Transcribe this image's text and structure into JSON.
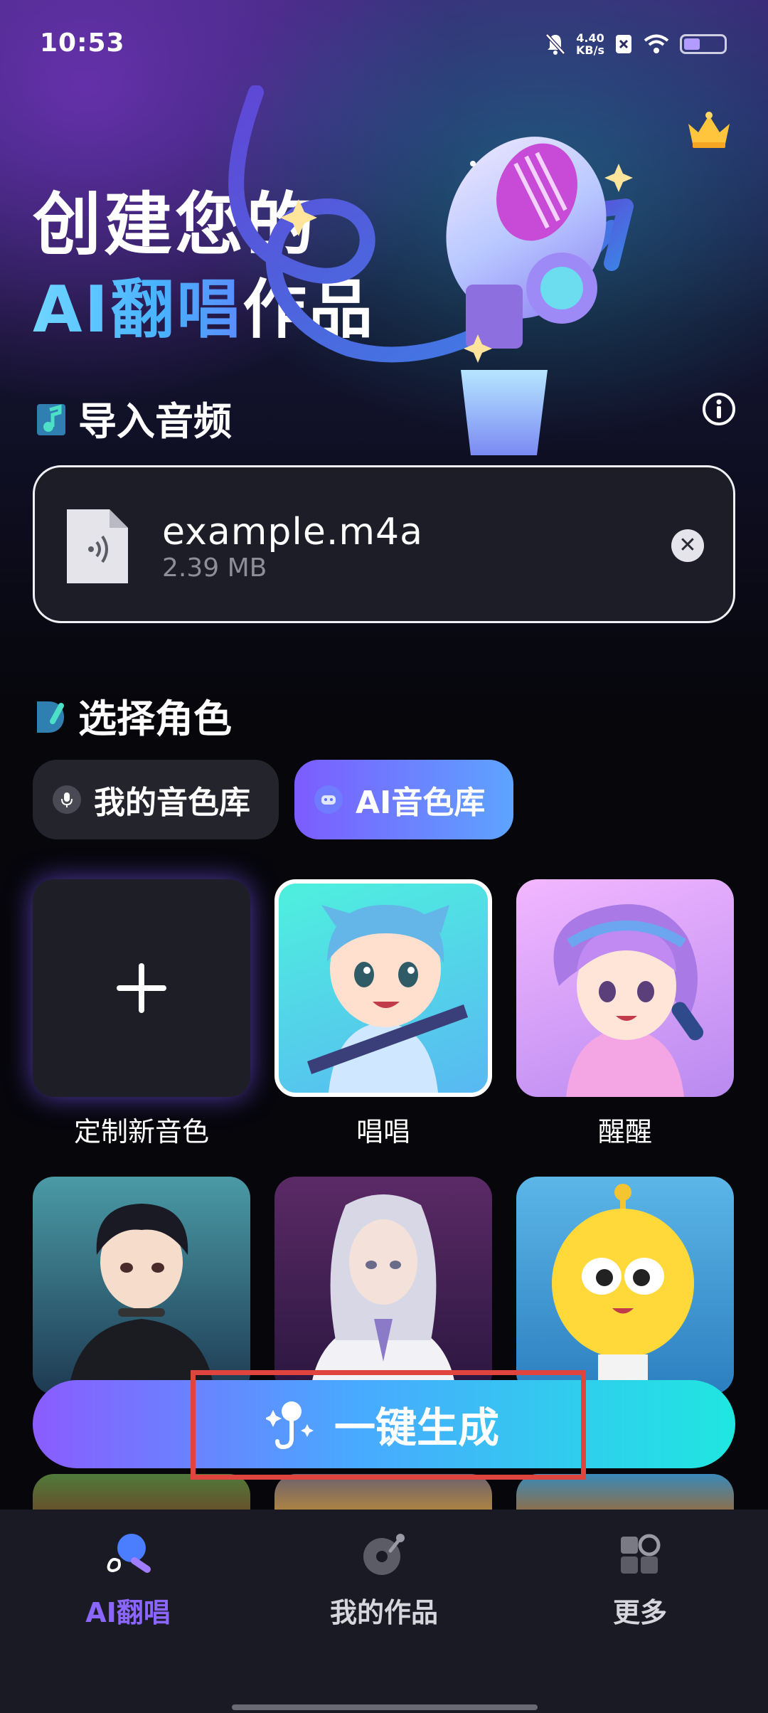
{
  "status_bar": {
    "time": "10:53",
    "net_speed_value": "4.40",
    "net_speed_unit": "KB/s",
    "battery_level": 0.4
  },
  "hero": {
    "line1": "创建您的",
    "line2_highlight": "AI翻唱",
    "line2_rest": "作品"
  },
  "import_section": {
    "title": "导入音频",
    "file": {
      "name": "example.m4a",
      "size": "2.39 MB"
    }
  },
  "role_section": {
    "title": "选择角色",
    "tabs": [
      {
        "label": "我的音色库",
        "active": false
      },
      {
        "label": "AI音色库",
        "active": true
      }
    ],
    "voices": [
      {
        "label": "定制新音色"
      },
      {
        "label": "唱唱"
      },
      {
        "label": "醒醒"
      }
    ]
  },
  "generate_button": {
    "label": "一键生成"
  },
  "bottom_nav": {
    "items": [
      {
        "label": "AI翻唱",
        "active": true
      },
      {
        "label": "我的作品",
        "active": false
      },
      {
        "label": "更多",
        "active": false
      }
    ]
  },
  "colors": {
    "accent_purple": "#7c5cff",
    "accent_cyan": "#1fe7e0",
    "highlight_red": "#e0443e",
    "nav_active": "#8a66ff"
  }
}
